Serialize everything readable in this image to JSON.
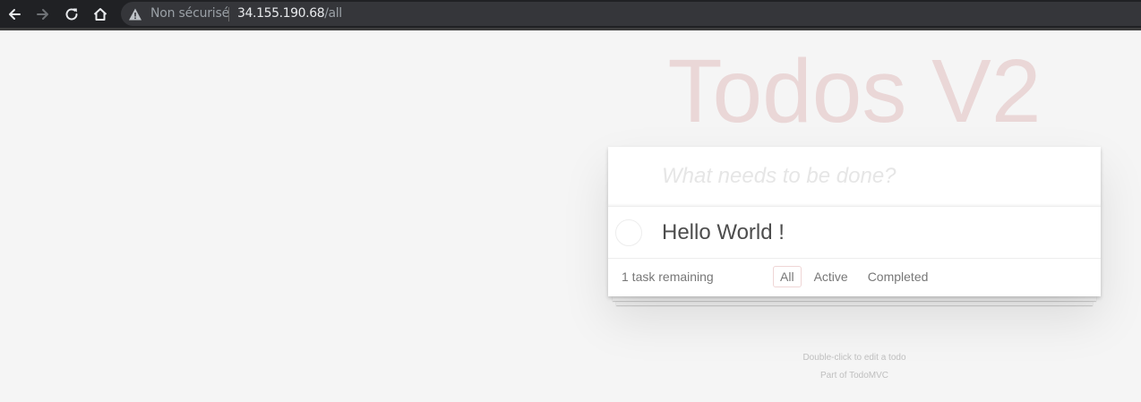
{
  "browser": {
    "security_label": "Non sécurisé",
    "url_host": "34.155.190.68",
    "url_path": "/all",
    "icons": {
      "back": "arrow-left-icon",
      "forward": "arrow-right-icon",
      "reload": "reload-icon",
      "home": "home-icon",
      "security": "warning-triangle-icon"
    }
  },
  "app": {
    "title": "Todos V2",
    "new_todo_placeholder": "What needs to be done?",
    "new_todo_value": "",
    "todos": [
      {
        "label": "Hello World !",
        "completed": false
      }
    ],
    "footer": {
      "count_text": "1 task remaining",
      "filters": [
        "All",
        "Active",
        "Completed"
      ],
      "selected_filter": "All"
    },
    "info": {
      "line1": "Double-click to edit a todo",
      "line2": "Part of TodoMVC"
    }
  },
  "colors": {
    "title": "#efd5d5",
    "page_background": "#f5f5f5",
    "browser_bar": "#202124",
    "omnibox": "#35363a"
  }
}
